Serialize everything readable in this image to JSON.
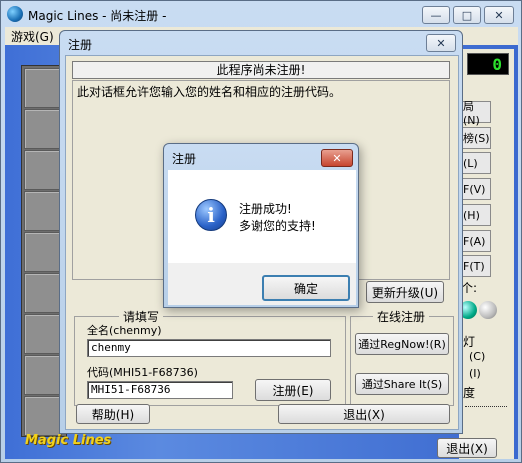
{
  "main_window": {
    "title": "Magic Lines - 尚未注册 -",
    "menu_game": "游戏(G)",
    "score": "0",
    "side_buttons": [
      "局(N)",
      "榜(S)",
      "(L)",
      "F(V)",
      "(H)",
      "F(A)",
      "F(T)"
    ],
    "side_label_count": "个:",
    "side_group_label": "灯",
    "side_opts": [
      "(C)",
      "(I)"
    ],
    "side_speed": "度",
    "exit_label": "退出(X)",
    "logo_text": "Magic Lines"
  },
  "register_dialog": {
    "title": "注册",
    "banner": "此程序尚未注册!",
    "description": "此对话框允许您输入您的姓名和相应的注册代码。",
    "upgrade_button": "更新升级(U)",
    "fill_group_label": "请填写",
    "name_label": "全名(chenmy)",
    "name_value": "chenmy",
    "code_label": "代码(MHI51-F68736)",
    "code_value": "MHI51-F68736",
    "register_button": "注册(E)",
    "online_group_label": "在线注册",
    "regnow_button": "通过RegNow!(R)",
    "shareit_button": "通过Share It(S)",
    "help_button": "帮助(H)",
    "exit_button": "退出(X)"
  },
  "message_box": {
    "title": "注册",
    "line1": "注册成功!",
    "line2": "多谢您的支持!",
    "ok_button": "确定"
  }
}
